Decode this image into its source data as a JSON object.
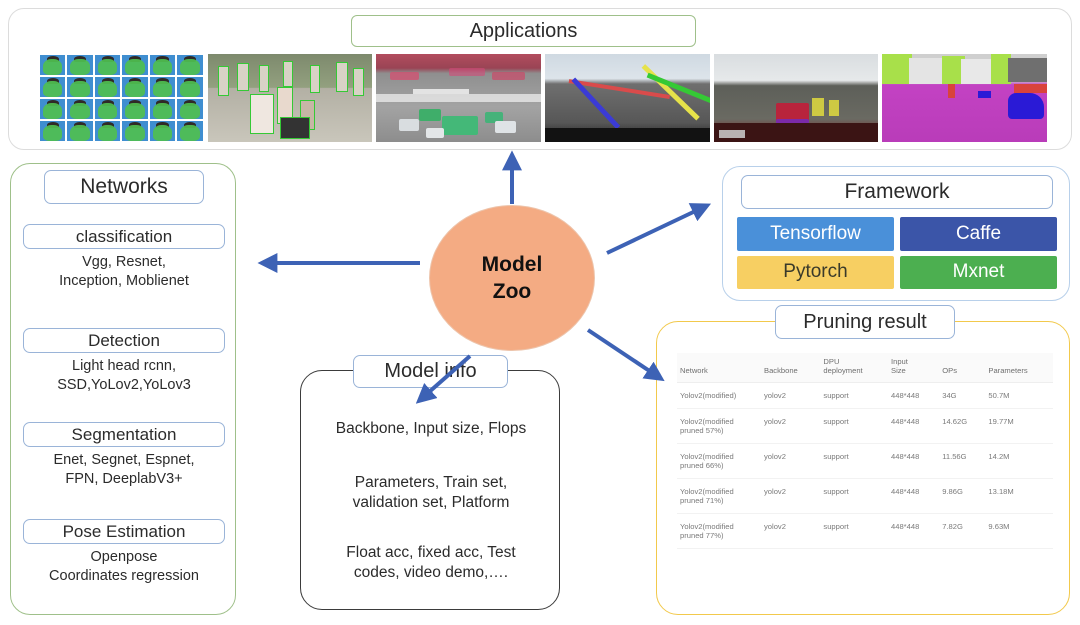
{
  "applications": {
    "label": "Applications",
    "photos": [
      {
        "name": "face-recognition-grid",
        "caption": "face recognition grid"
      },
      {
        "name": "pedestrian-detection",
        "caption": "pedestrian detection"
      },
      {
        "name": "traffic-intersection-detection",
        "caption": "traffic intersection detection"
      },
      {
        "name": "lane-detection",
        "caption": "lane detection"
      },
      {
        "name": "dashcam-driving-scene",
        "caption": "dashcam driving scene"
      },
      {
        "name": "semantic-segmentation",
        "caption": "semantic segmentation"
      }
    ]
  },
  "center": {
    "line1": "Model",
    "line2": "Zoo",
    "fill": "#f4ab83"
  },
  "networks": {
    "title": "Networks",
    "groups": [
      {
        "head": "classification",
        "body": "Vgg, Resnet,\nInception, Moblienet"
      },
      {
        "head": "Detection",
        "body": "Light head rcnn,\nSSD,YoLov2,YoLov3"
      },
      {
        "head": "Segmentation",
        "body": "Enet, Segnet, Espnet,\nFPN, DeeplabV3+"
      },
      {
        "head": "Pose Estimation",
        "body": "Openpose\nCoordinates regression"
      }
    ],
    "border_color": "#9fc08a"
  },
  "framework": {
    "title": "Framework",
    "border_color": "#b8d0ea",
    "items": [
      {
        "label": "Tensorflow",
        "bg": "#4a90d9",
        "fg": "#ffffff"
      },
      {
        "label": "Caffe",
        "bg": "#3b55a8",
        "fg": "#ffffff"
      },
      {
        "label": "Pytorch",
        "bg": "#f7cf62",
        "fg": "#3a3a2a"
      },
      {
        "label": "Mxnet",
        "bg": "#4caf50",
        "fg": "#ffffff"
      }
    ]
  },
  "model_info": {
    "title": "Model info",
    "border_color": "#3b3b3b",
    "lines": [
      "Backbone, Input size, Flops",
      "Parameters, Train set,\nvalidation set, Platform",
      "Float acc, fixed acc, Test\ncodes, video demo,…."
    ]
  },
  "pruning": {
    "title": "Pruning result",
    "border_color": "#f2c94c",
    "columns": [
      "Network",
      "Backbone",
      "DPU\ndeployment",
      "Input\nSize",
      "OPs",
      "Parameters"
    ],
    "rows": [
      [
        "Yolov2(modified)",
        "yolov2",
        "support",
        "448*448",
        "34G",
        "50.7M"
      ],
      [
        "Yolov2(modified\npruned 57%)",
        "yolov2",
        "support",
        "448*448",
        "14.62G",
        "19.77M"
      ],
      [
        "Yolov2(modified\npruned 66%)",
        "yolov2",
        "support",
        "448*448",
        "11.56G",
        "14.2M"
      ],
      [
        "Yolov2(modified\npruned 71%)",
        "yolov2",
        "support",
        "448*448",
        "9.86G",
        "13.18M"
      ],
      [
        "Yolov2(modified\npruned 77%)",
        "yolov2",
        "support",
        "448*448",
        "7.82G",
        "9.63M"
      ]
    ]
  },
  "arrows": {
    "color": "#3d62b5",
    "list": [
      {
        "name": "arrow-to-applications",
        "target": "Applications"
      },
      {
        "name": "arrow-to-networks",
        "target": "Networks"
      },
      {
        "name": "arrow-to-framework",
        "target": "Framework"
      },
      {
        "name": "arrow-to-model-info",
        "target": "Model info"
      },
      {
        "name": "arrow-to-pruning-result",
        "target": "Pruning result"
      }
    ]
  }
}
